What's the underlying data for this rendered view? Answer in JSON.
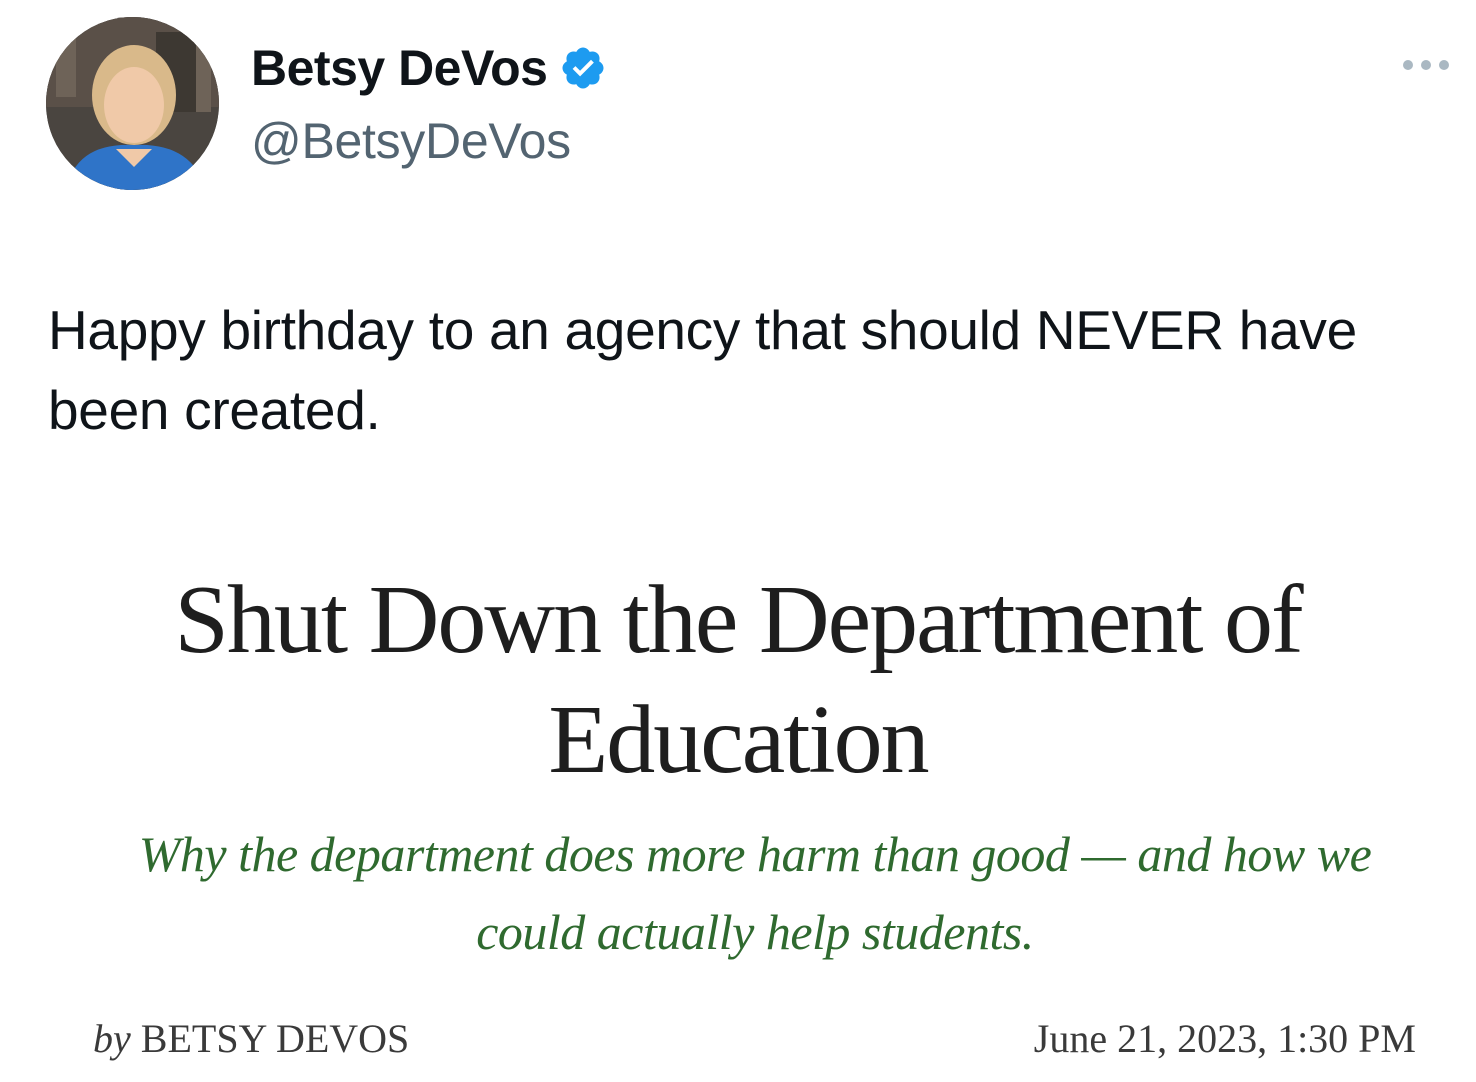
{
  "author": {
    "display_name": "Betsy DeVos",
    "handle": "@BetsyDeVos",
    "verified_icon": "verified-badge-icon",
    "avatar_icon": "profile-photo"
  },
  "tweet": {
    "text": "Happy birthday to an agency that should NEVER have been created."
  },
  "article_card": {
    "title": "Shut Down the Department of Education",
    "subtitle": "Why the department does more harm than good — and how we could actually help students.",
    "byline_prefix": "by",
    "byline_author": "BETSY DEVOS",
    "date": "June 21, 2023, 1:30 PM"
  },
  "menu": {
    "more_icon": "more-options-icon"
  },
  "colors": {
    "verified_blue": "#1d9bf0",
    "handle_gray": "#536471",
    "subtitle_green": "#2f6a2f"
  }
}
